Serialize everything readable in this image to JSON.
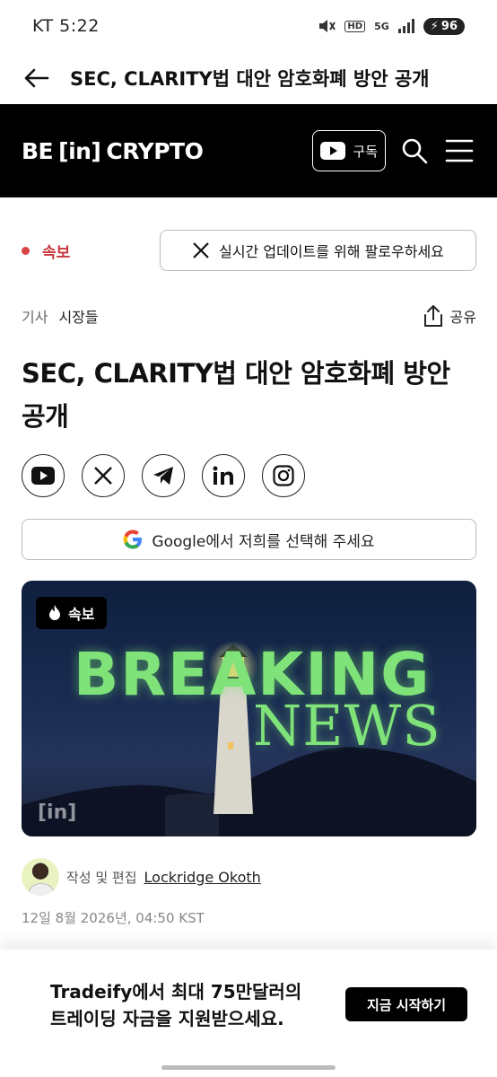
{
  "status_bar": {
    "carrier_time": "KT 5:22",
    "hd": "HD",
    "net": "5G",
    "battery": "96"
  },
  "browser": {
    "title": "SEC, CLARITY법 대안 암호화폐 방안 공개"
  },
  "site_nav": {
    "logo_left": "BE",
    "logo_middle": "[in]",
    "logo_right": "CRYPTO",
    "subscribe_label": "구독"
  },
  "breaking": {
    "label": "속보",
    "follow_label": "실시간 업데이트를 위해 팔로우하세요"
  },
  "category": {
    "crumb_1": "기사",
    "crumb_2": "시장들",
    "share_label": "공유"
  },
  "article": {
    "title": "SEC, CLARITY법 대안 암호화폐 방안 공개",
    "google_label": "Google에서 저희를 선택해 주세요"
  },
  "social_icons": [
    "youtube-icon",
    "x-icon",
    "telegram-icon",
    "linkedin-icon",
    "instagram-icon"
  ],
  "hero": {
    "badge": "속보",
    "headline_1": "BREAKING",
    "headline_2": "NEWS",
    "watermark": "[in]"
  },
  "author": {
    "prefix": "작성 및 편집",
    "name": "Lockridge Okoth"
  },
  "date": "12일 8월 2026년, 04:50 KST",
  "ad": {
    "text": "Tradeify에서 최대 75만달러의 트레이딩 자금을 지원받으세요.",
    "button": "지금 시작하기"
  },
  "colors": {
    "accent_red": "#c7373d",
    "nav_bg": "#000000",
    "headline_green": "#7fe37a"
  }
}
